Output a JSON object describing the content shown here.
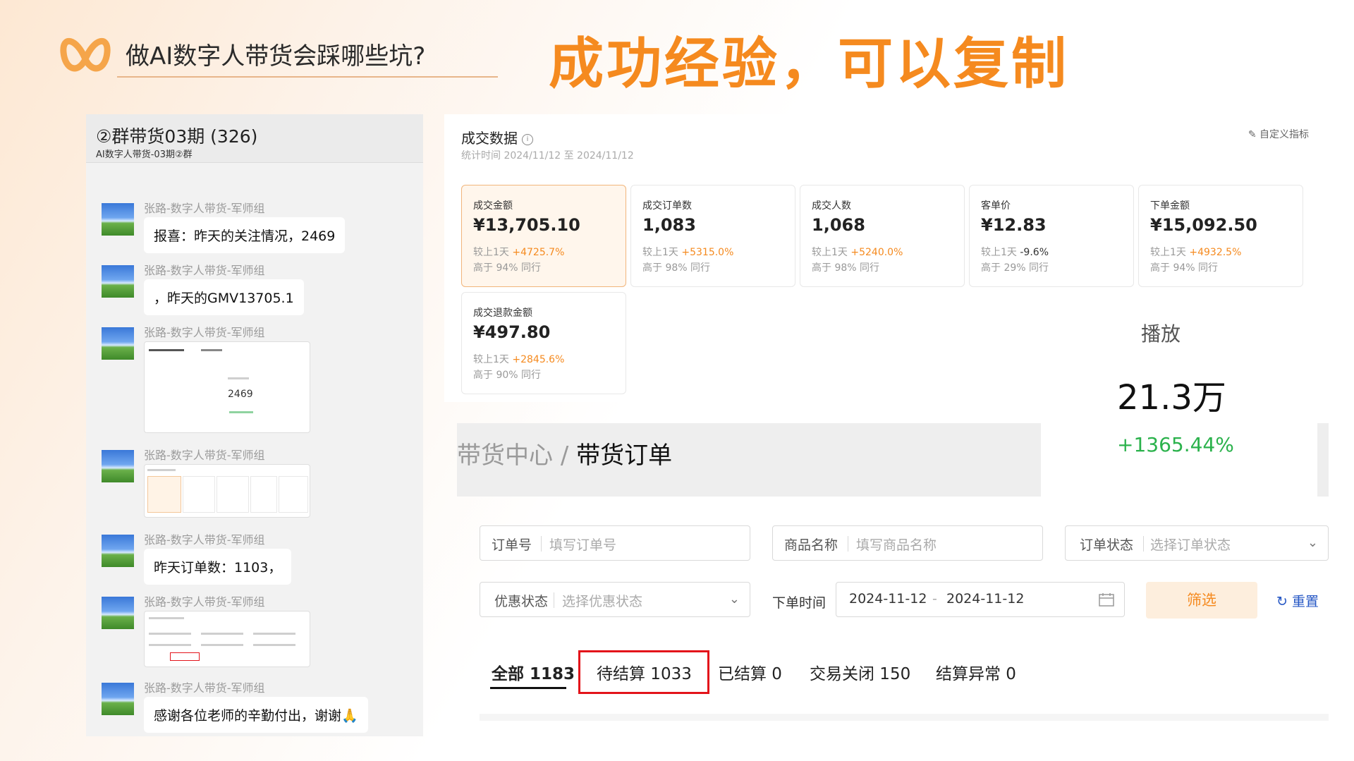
{
  "header": {
    "deck_title": "做AI数字人带货会踩哪些坑?",
    "slogan": "成功经验，可以复制",
    "accent_color": "#f58a1f",
    "logo_icon": "orange-loop-logo-icon"
  },
  "chat": {
    "group_title": "②群带货03期 (326)",
    "group_subtitle": "AI数字人带货-03期②群",
    "messages": [
      {
        "sender": "张路-数字人带货-军师组",
        "text": "报喜：昨天的关注情况，2469"
      },
      {
        "sender": "张路-数字人带货-军师组",
        "text": "，昨天的GMV13705.1"
      },
      {
        "sender": "张路-数字人带货-军师组",
        "image_value": "2469"
      },
      {
        "sender": "张路-数字人带货-军师组"
      },
      {
        "sender": "张路-数字人带货-军师组",
        "text": "昨天订单数：1103，"
      },
      {
        "sender": "张路-数字人带货-军师组"
      },
      {
        "sender": "张路-数字人带货-军师组",
        "text": "感谢各位老师的辛勤付出，谢谢🙏"
      }
    ]
  },
  "dashboard": {
    "title": "成交数据",
    "period": "统计时间 2024/11/12 至 2024/11/12",
    "custom_link": "自定义指标",
    "cmp_prefix": "较上1天",
    "cards": [
      {
        "label": "成交金额",
        "value": "¥13,705.10",
        "change": "+4725.7%",
        "peer": "高于 94% 同行"
      },
      {
        "label": "成交订单数",
        "value": "1,083",
        "change": "+5315.0%",
        "peer": "高于 98% 同行"
      },
      {
        "label": "成交人数",
        "value": "1,068",
        "change": "+5240.0%",
        "peer": "高于 98% 同行"
      },
      {
        "label": "客单价",
        "value": "¥12.83",
        "change": "-9.6%",
        "peer": "高于 29% 同行"
      },
      {
        "label": "下单金额",
        "value": "¥15,092.50",
        "change": "+4932.5%",
        "peer": "高于 94% 同行"
      },
      {
        "label": "成交退款金额",
        "value": "¥497.80",
        "change": "+2845.6%",
        "peer": "高于 90% 同行"
      }
    ]
  },
  "play": {
    "label": "播放",
    "value": "21.3万",
    "change": "+1365.44%"
  },
  "orders": {
    "breadcrumb_parent": "带货中心",
    "breadcrumb_sep": "/",
    "breadcrumb_current": "带货订单",
    "order_no_label": "订单号",
    "order_no_placeholder": "填写订单号",
    "product_label": "商品名称",
    "product_placeholder": "填写商品名称",
    "status_label": "订单状态",
    "status_placeholder": "选择订单状态",
    "coupon_label": "优惠状态",
    "coupon_placeholder": "选择优惠状态",
    "time_label": "下单时间",
    "date_from": "2024-11-12",
    "date_sep": "-",
    "date_to": "2024-11-12",
    "filter_button": "筛选",
    "reset_button": "重置",
    "tabs": [
      "全部 1183",
      "待结算 1033",
      "已结算 0",
      "交易关闭 150",
      "结算异常 0"
    ]
  }
}
